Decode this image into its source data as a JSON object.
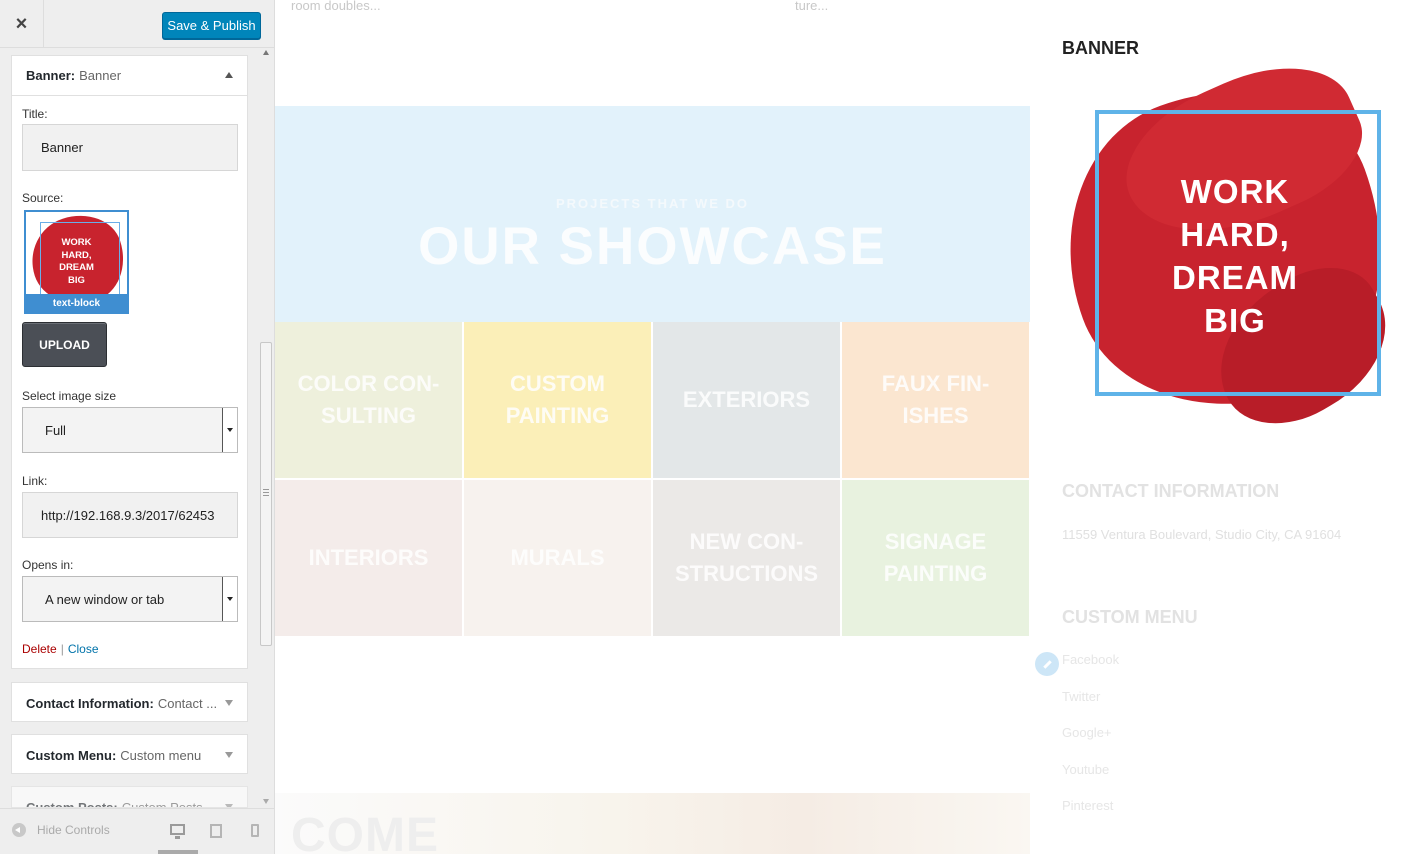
{
  "toolbar": {
    "close_symbol": "×",
    "publish_label": "Save & Publish"
  },
  "banner_panel": {
    "heading_bold": "Banner:",
    "heading_sub": "Banner",
    "title_label": "Title:",
    "title_value": "Banner",
    "source_label": "Source:",
    "thumb_text": "WORK\nHARD,\nDREAM\nBIG",
    "thumb_tag": "text-block",
    "upload_label": "UPLOAD",
    "size_label": "Select image size",
    "size_value": "Full",
    "link_label": "Link:",
    "link_value": "http://192.168.9.3/2017/62453",
    "opens_label": "Opens in:",
    "opens_value": "A new window or tab",
    "delete_label": "Delete",
    "separator": "|",
    "close_label": "Close"
  },
  "collapsed_panels": [
    {
      "bold": "Contact Information:",
      "sub": "Contact ..."
    },
    {
      "bold": "Custom Menu:",
      "sub": "Custom menu"
    },
    {
      "bold": "Custom Posts:",
      "sub": "Custom Posts"
    }
  ],
  "footer": {
    "hide_label": "Hide Controls"
  },
  "preview": {
    "top_snippets": [
      "room doubles...",
      "ture..."
    ],
    "showcase_sub": "PROJECTS THAT WE DO",
    "showcase_title": "OUR SHOWCASE",
    "tiles": [
      {
        "label": "COLOR CON-\nSULTING",
        "bg": "#eef0dc"
      },
      {
        "label": "CUSTOM\nPAINTING",
        "bg": "#fbefb8"
      },
      {
        "label": "EXTERIORS",
        "bg": "#e3e7e8"
      },
      {
        "label": "FAUX FIN-\nISHES",
        "bg": "#fbe6d0"
      },
      {
        "label": "INTERIORS",
        "bg": "#f4ecea"
      },
      {
        "label": "MURALS",
        "bg": "#f7f2ee"
      },
      {
        "label": "NEW CON-\nSTRUCTIONS",
        "bg": "#ebe9e7"
      },
      {
        "label": "SIGNAGE\nPAINTING",
        "bg": "#e8f2df"
      }
    ],
    "come_text": "COME",
    "widget_title": "BANNER",
    "banner_text": "WORK\nHARD,\nDREAM\nBIG",
    "contact_heading": "CONTACT INFORMATION",
    "address": "11559 Ventura Boulevard, Studio City, CA 91604",
    "menu_heading": "CUSTOM MENU",
    "menu_items": [
      "Facebook",
      "Twitter",
      "Google+",
      "Youtube",
      "Pinterest"
    ]
  },
  "colors": {
    "accent": "#0085ba",
    "link": "#0073aa",
    "delete": "#aa0000",
    "brand_red": "#c8232e",
    "frame_blue": "#5fb3e8"
  }
}
